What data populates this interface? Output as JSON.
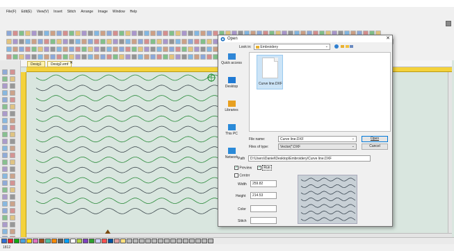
{
  "menubar": {
    "items": [
      "File(F)",
      "Edit(E)",
      "View(V)",
      "Insert",
      "Stitch",
      "Arrange",
      "Image",
      "Window",
      "Help"
    ]
  },
  "document_tabs": [
    "Desig1",
    "Desig2.emf"
  ],
  "status": {
    "text": "1812"
  },
  "palette": {
    "colors": [
      "#2f6fd6",
      "#e23",
      "#1a1",
      "#4aa3e0",
      "#f7d000",
      "#e070c0",
      "#a05020",
      "#50c0a0",
      "#ff8800",
      "#606060",
      "#00a0ff",
      "#ffffff",
      "#b0d040",
      "#8040c0",
      "#30a030",
      "#d0d0ff",
      "#ff5050",
      "#0050a0",
      "#e0a0a0",
      "#ffe080"
    ]
  },
  "canvas": {
    "wave_colors": [
      "#2a8a3a",
      "#3f4b50"
    ]
  },
  "dialog": {
    "title": "Open",
    "close": "✕",
    "look_in_label": "Look in:",
    "look_in_value": "Embroidery",
    "places": [
      {
        "label": "Quick access",
        "icon": "star-icon",
        "color": "#2f86d6"
      },
      {
        "label": "Desktop",
        "icon": "desktop-icon",
        "color": "#1f7ad4"
      },
      {
        "label": "Libraries",
        "icon": "library-icon",
        "color": "#e8a020"
      },
      {
        "label": "This PC",
        "icon": "computer-icon",
        "color": "#2a8ad8"
      },
      {
        "label": "Network",
        "icon": "network-icon",
        "color": "#2a8ad8"
      }
    ],
    "file_item": "Curve line.DXF",
    "file_name_label": "File name:",
    "file_name_value": "Curve line.DXF",
    "file_type_label": "Files of type:",
    "file_type_value": "Vector(*.DXF",
    "open_button": "Open",
    "cancel_button": "Cancel",
    "path_label": "Path",
    "path_value": "D:\\Users\\Daniel\\Desktop\\Embroidery\\Curve line.DXF",
    "preview_label": "Preview",
    "preview_checked": true,
    "run_label": "Run",
    "run_checked": true,
    "center_label": "Center",
    "center_checked": false,
    "width_label": "Width",
    "width_value": "259.82",
    "height_label": "Height",
    "height_value": "214.53",
    "color_label": "Color",
    "color_value": "",
    "stitch_label": "Stitch",
    "stitch_value": ""
  }
}
